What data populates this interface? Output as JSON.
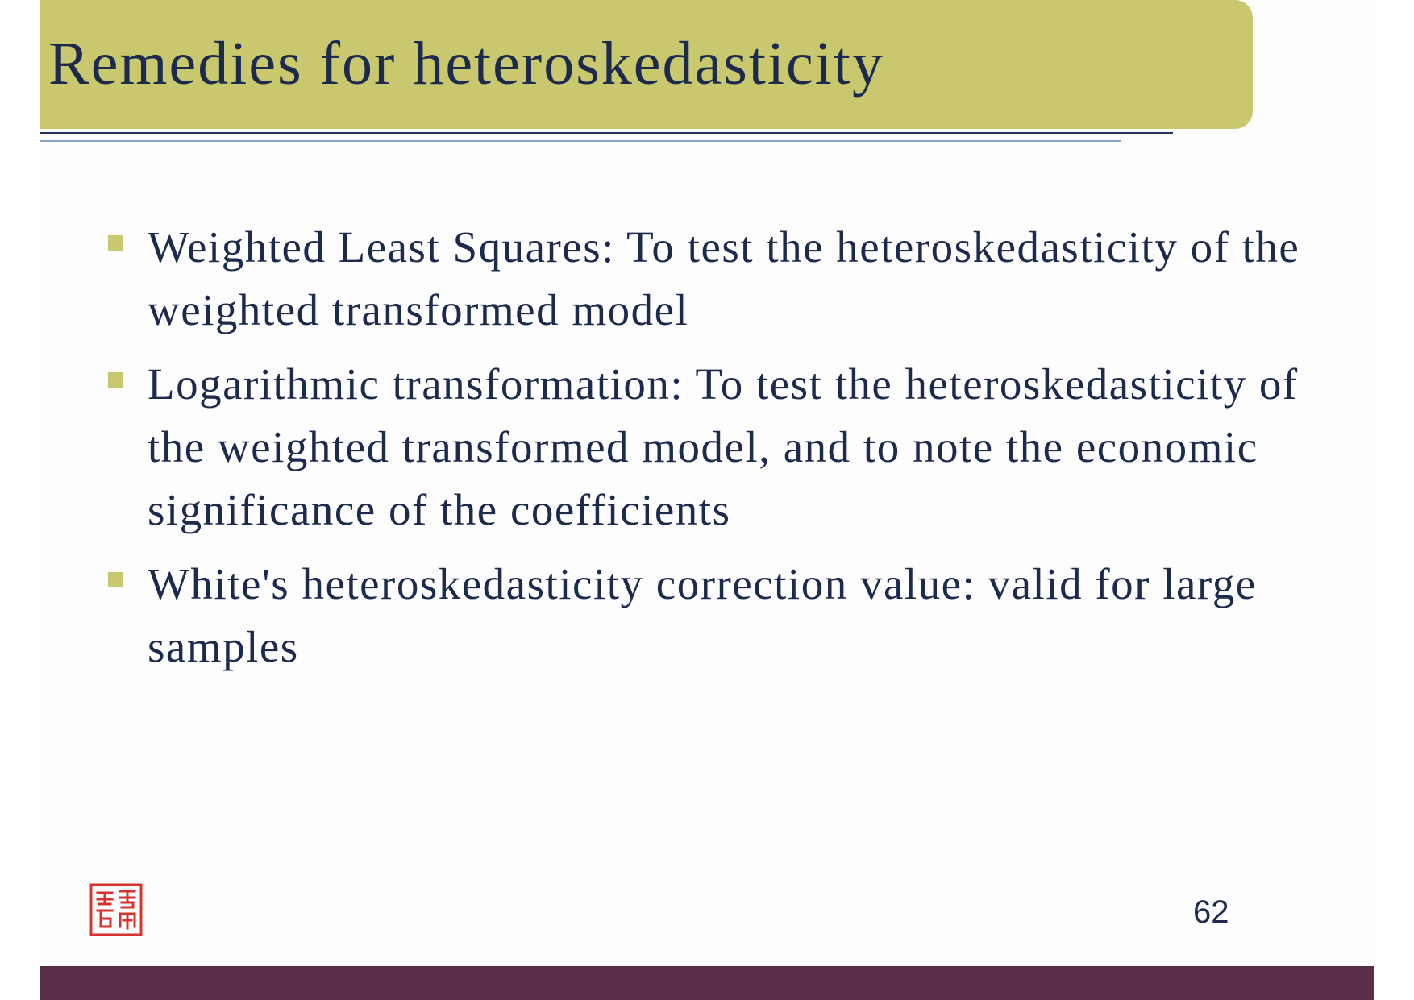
{
  "colors": {
    "title_bar": "#c9c86f",
    "text": "#1c2b4d",
    "rule_dark": "#22345c",
    "rule_light": "#8aa2c8",
    "bullet": "#c9c86f",
    "seal": "#d8322e",
    "footer_bar": "#5a2d48"
  },
  "slide": {
    "title": "Remedies for heteroskedasticity",
    "bullets": [
      {
        "text": "Weighted Least Squares: To test the heteroskedasticity of the weighted transformed model"
      },
      {
        "text": "Logarithmic transformation: To test the heteroskedasticity of the weighted transformed model, and to note the economic significance of the coefficients"
      },
      {
        "text": "White's heteroskedasticity correction value: valid for large samples"
      }
    ],
    "page_number": "62",
    "seal_icon": "red-seal-icon"
  }
}
